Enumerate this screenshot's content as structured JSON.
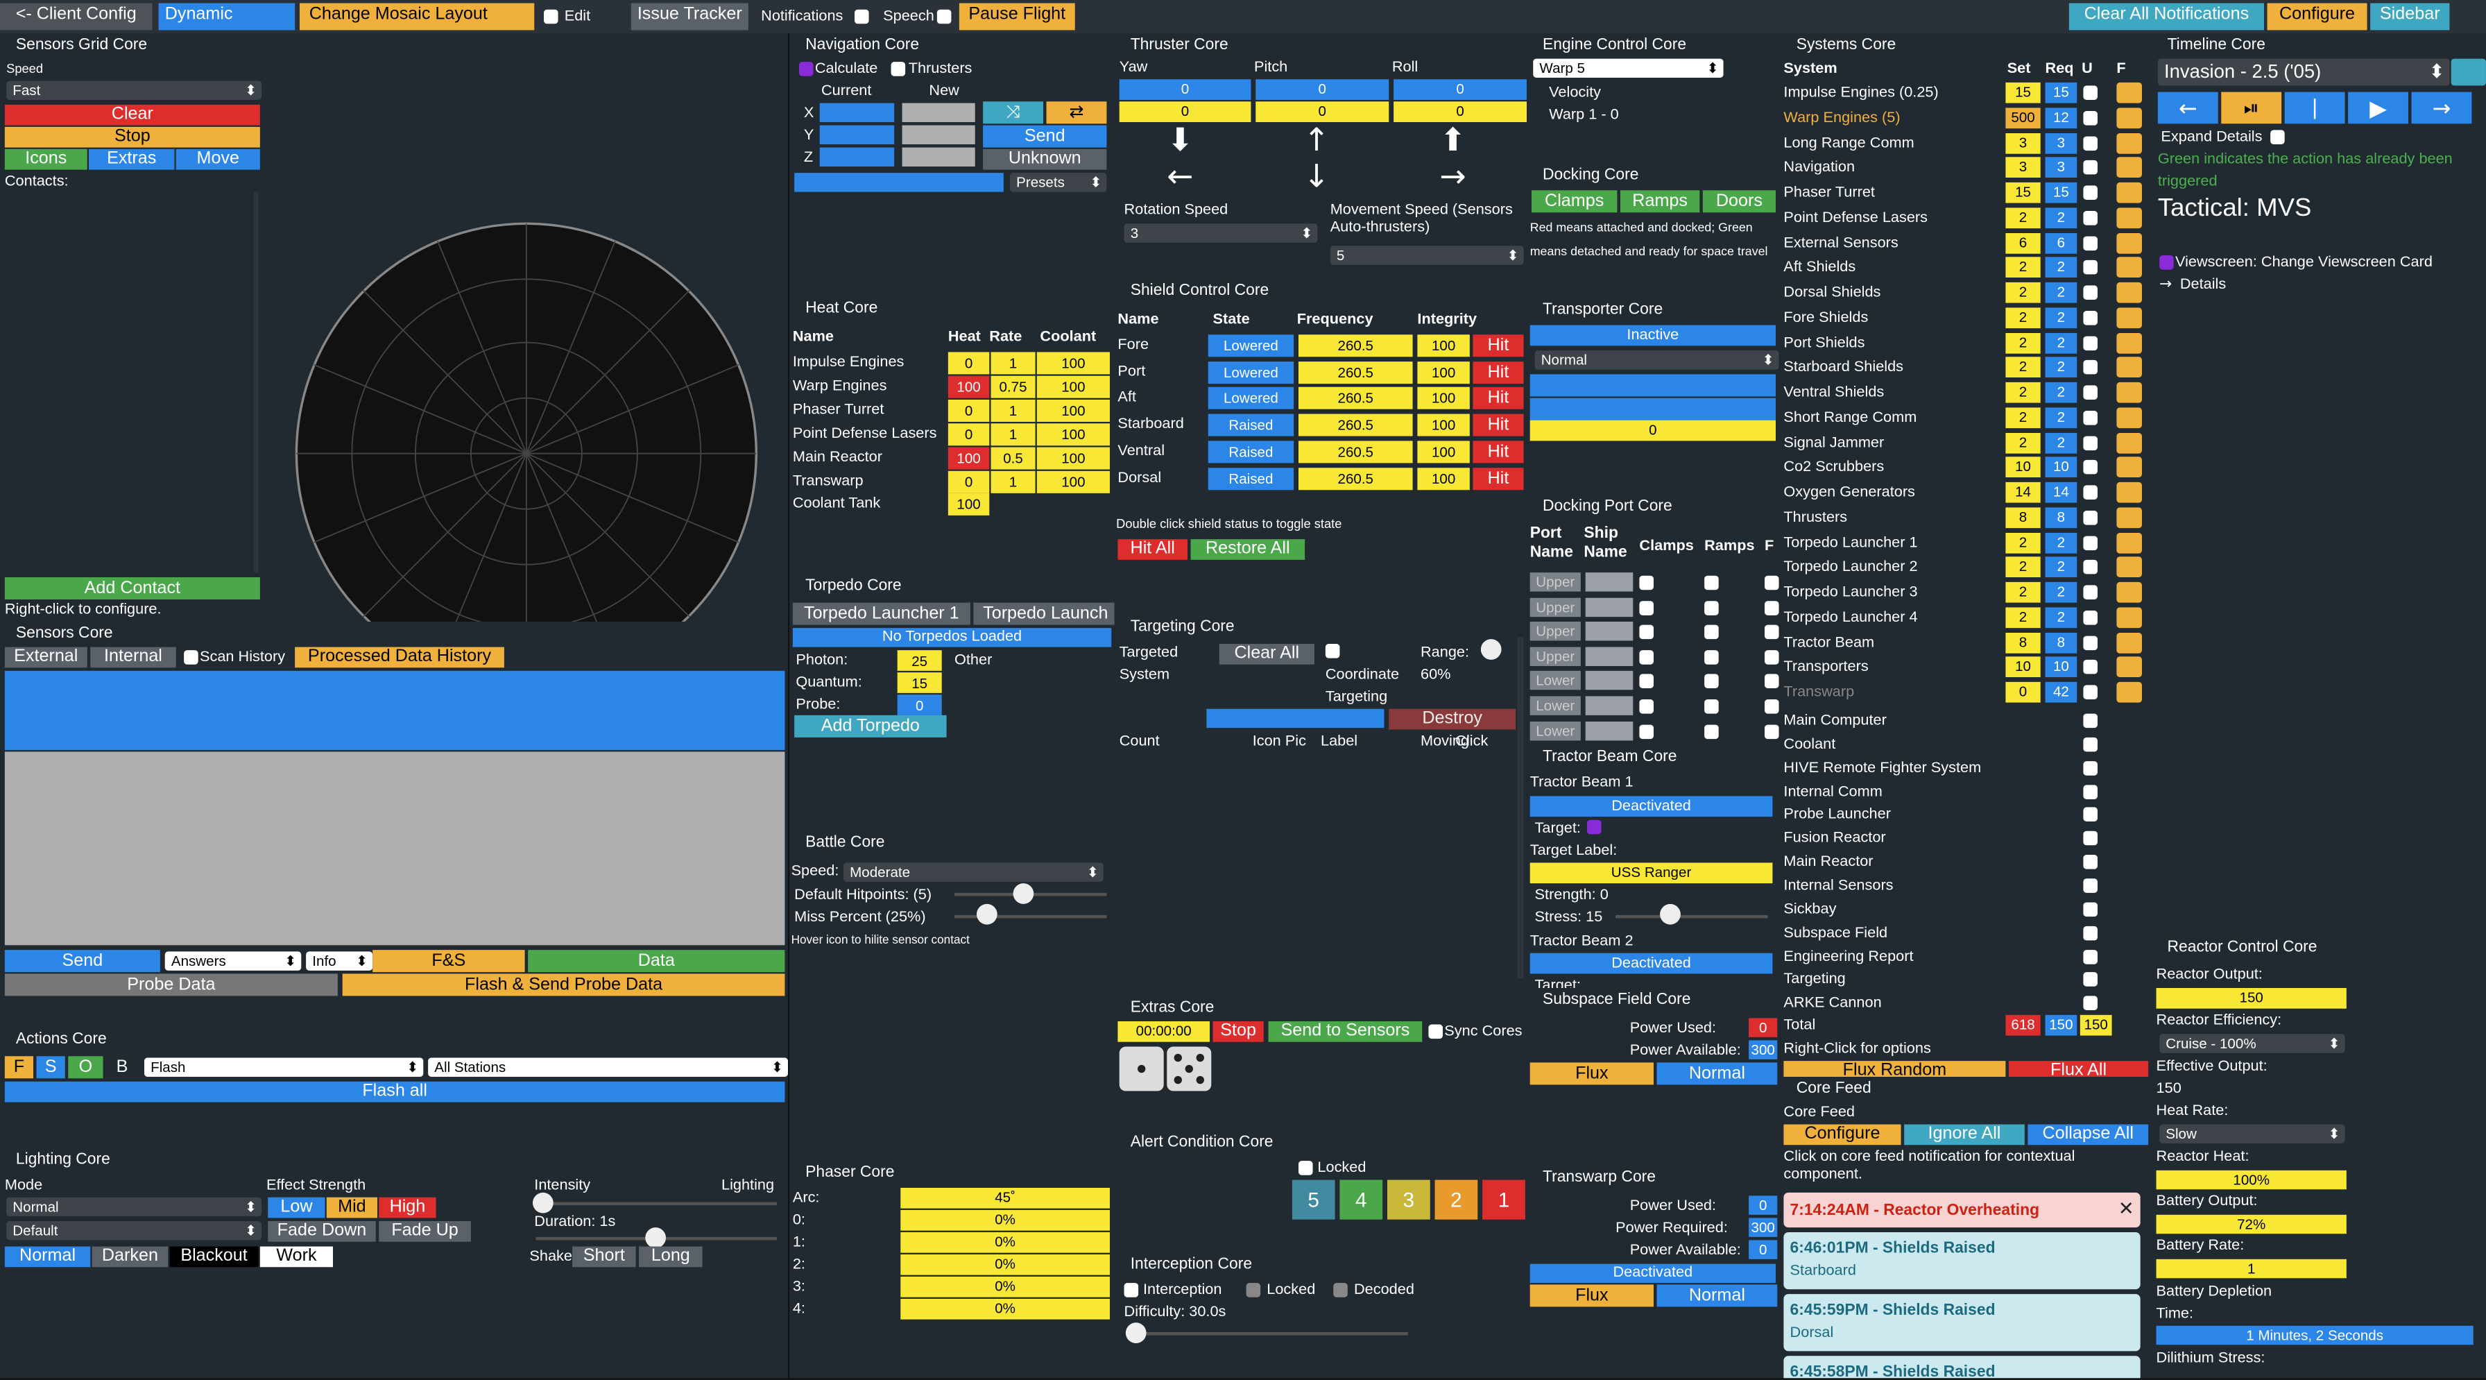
{
  "topbar": {
    "client_config": "<- Client Config",
    "layout": "Dynamic",
    "change_mosaic": "Change Mosaic Layout",
    "edit": "Edit",
    "issue_tracker": "Issue Tracker",
    "notifications": "Notifications",
    "speech": "Speech",
    "pause_flight": "Pause Flight",
    "clear_all": "Clear All Notifications",
    "configure": "Configure",
    "sidebar": "Sidebar"
  },
  "sensors_grid": {
    "title": "Sensors Grid Core",
    "speed_label": "Speed",
    "speed_value": "Fast",
    "clear": "Clear",
    "stop": "Stop",
    "icons": "Icons",
    "extras": "Extras",
    "move": "Move",
    "contacts": "Contacts:",
    "add_contact": "Add Contact",
    "right_click": "Right-click to configure."
  },
  "sensors_core": {
    "title": "Sensors Core",
    "external": "External",
    "internal": "Internal",
    "scan_history": "Scan History",
    "processed": "Processed Data History",
    "send": "Send",
    "answers": "Answers",
    "info": "Info",
    "fs": "F&S",
    "data": "Data",
    "probe_data": "Probe Data",
    "flash_send": "Flash & Send Probe Data"
  },
  "actions": {
    "title": "Actions Core",
    "f": "F",
    "s": "S",
    "o": "O",
    "b": "B",
    "action": "Flash",
    "stations": "All Stations",
    "flash_all": "Flash all"
  },
  "lighting": {
    "title": "Lighting Core",
    "mode": "Mode",
    "mode_value": "Normal",
    "default_value": "Default",
    "effect": "Effect Strength",
    "low": "Low",
    "mid": "Mid",
    "high": "High",
    "fade_down": "Fade Down",
    "fade_up": "Fade Up",
    "normal": "Normal",
    "darken": "Darken",
    "blackout": "Blackout",
    "work": "Work",
    "intensity": "Intensity",
    "lighting": "Lighting",
    "duration": "Duration: 1s",
    "shake": "Shake:",
    "short": "Short",
    "long": "Long"
  },
  "nav": {
    "title": "Navigation Core",
    "calculate": "Calculate",
    "thrusters": "Thrusters",
    "current": "Current",
    "new": "New",
    "x": "X",
    "y": "Y",
    "z": "Z",
    "send": "Send",
    "unknown": "Unknown",
    "presets": "Presets"
  },
  "heat": {
    "title": "Heat Core",
    "headers": [
      "Name",
      "Heat",
      "Rate",
      "Coolant"
    ],
    "rows": [
      [
        "Impulse Engines",
        "0",
        "1",
        "100"
      ],
      [
        "Warp Engines",
        "100",
        "0.75",
        "100"
      ],
      [
        "Phaser Turret",
        "0",
        "1",
        "100"
      ],
      [
        "Point Defense Lasers",
        "0",
        "1",
        "100"
      ],
      [
        "Main Reactor",
        "100",
        "0.5",
        "100"
      ],
      [
        "Transwarp",
        "0",
        "1",
        "100"
      ]
    ],
    "coolant_tank": "Coolant Tank",
    "coolant_value": "100"
  },
  "torpedo": {
    "title": "Torpedo Core",
    "tab1": "Torpedo Launcher 1",
    "tab2": "Torpedo Launch",
    "none": "No Torpedos Loaded",
    "photon": "Photon:",
    "photon_v": "25",
    "other": "Other",
    "quantum": "Quantum:",
    "quantum_v": "15",
    "probe": "Probe:",
    "probe_v": "0",
    "add": "Add Torpedo"
  },
  "battle": {
    "title": "Battle Core",
    "speed": "Speed:",
    "speed_v": "Moderate",
    "hp": "Default  Hitpoints:  (5)",
    "miss": "Miss  Percent  (25%)",
    "hover": "Hover icon to hilite sensor contact"
  },
  "phaser": {
    "title": "Phaser Core",
    "rows": [
      [
        "Arc:",
        "45˚"
      ],
      [
        "0:",
        "0%"
      ],
      [
        "1:",
        "0%"
      ],
      [
        "2:",
        "0%"
      ],
      [
        "3:",
        "0%"
      ],
      [
        "4:",
        "0%"
      ]
    ]
  },
  "thruster": {
    "title": "Thruster Core",
    "yaw": "Yaw",
    "pitch": "Pitch",
    "roll": "Roll",
    "v": "0",
    "rot": "Rotation Speed",
    "rot_v": "3",
    "move": "Movement Speed (Sensors Auto-thrusters)",
    "move_v": "5"
  },
  "shield": {
    "title": "Shield Control Core",
    "headers": [
      "Name",
      "State",
      "Frequency",
      "Integrity"
    ],
    "rows": [
      [
        "Fore",
        "Lowered",
        "260.5",
        "100"
      ],
      [
        "Port",
        "Lowered",
        "260.5",
        "100"
      ],
      [
        "Aft",
        "Lowered",
        "260.5",
        "100"
      ],
      [
        "Starboard",
        "Raised",
        "260.5",
        "100"
      ],
      [
        "Ventral",
        "Raised",
        "260.5",
        "100"
      ],
      [
        "Dorsal",
        "Raised",
        "260.5",
        "100"
      ]
    ],
    "hit": "Hit",
    "note": "Double click shield status to toggle state",
    "hit_all": "Hit All",
    "restore_all": "Restore All"
  },
  "targeting": {
    "title": "Targeting Core",
    "targeted": "Targeted",
    "system": "System",
    "clear_all": "Clear All",
    "coordinate": "Coordinate",
    "targeting": "Targeting",
    "range": "Range:",
    "range_v": "60%",
    "destroy": "Destroy",
    "count": "Count",
    "icon_pic": "Icon Pic",
    "label": "Label",
    "moving": "Moving",
    "click": "Click"
  },
  "extras": {
    "title": "Extras Core",
    "time": "00:00:00",
    "stop": "Stop",
    "send": "Send to Sensors",
    "sync": "Sync Cores"
  },
  "alert": {
    "title": "Alert Condition Core",
    "locked": "Locked",
    "levels": [
      "5",
      "4",
      "3",
      "2",
      "1"
    ]
  },
  "interception": {
    "title": "Interception Core",
    "interception": "Interception",
    "locked": "Locked",
    "decoded": "Decoded",
    "difficulty": "Difficulty: 30.0s"
  },
  "engine": {
    "title": "Engine Control Core",
    "warp": "Warp 5",
    "velocity": "Velocity",
    "warp_v": "Warp 1 - 0"
  },
  "docking": {
    "title": "Docking Core",
    "clamps": "Clamps",
    "ramps": "Ramps",
    "doors": "Doors",
    "note": "Red means attached and docked; Green means detached and ready for space travel"
  },
  "transporter": {
    "title": "Transporter Core",
    "inactive": "Inactive",
    "normal": "Normal",
    "v": "0"
  },
  "docking_port": {
    "title": "Docking Port Core",
    "port": "Port Name",
    "ship": "Ship Name",
    "clamps": "Clamps",
    "ramps": "Ramps",
    "f": "F",
    "ports": [
      "Upper",
      "Upper",
      "Upper",
      "Upper",
      "Lower",
      "Lower",
      "Lower"
    ]
  },
  "tractor": {
    "title": "Tractor Beam Core",
    "b1": "Tractor Beam 1",
    "deactivated": "Deactivated",
    "target": "Target:",
    "target_label": "Target Label:",
    "ranger": "USS Ranger",
    "strength": "Strength: 0",
    "stress": "Stress: 15",
    "b2": "Tractor Beam 2"
  },
  "subspace": {
    "title": "Subspace Field Core",
    "used": "Power Used:",
    "used_v": "0",
    "avail": "Power Available:",
    "avail_v": "300",
    "flux": "Flux",
    "normal": "Normal"
  },
  "transwarp": {
    "title": "Transwarp Core",
    "used": "Power Used:",
    "used_v": "0",
    "req": "Power Required:",
    "req_v": "300",
    "avail": "Power Available:",
    "avail_v": "0",
    "deactivated": "Deactivated",
    "flux": "Flux",
    "normal": "Normal"
  },
  "systems": {
    "title": "Systems Core",
    "headers": [
      "System",
      "Set",
      "Req",
      "U",
      "F"
    ],
    "rows": [
      [
        "Impulse Engines (0.25)",
        "15",
        "15"
      ],
      [
        "Warp Engines (5)",
        "500",
        "12"
      ],
      [
        "Long Range Comm",
        "3",
        "3"
      ],
      [
        "Navigation",
        "3",
        "3"
      ],
      [
        "Phaser Turret",
        "15",
        "15"
      ],
      [
        "Point Defense Lasers",
        "2",
        "2"
      ],
      [
        "External Sensors",
        "6",
        "6"
      ],
      [
        "Aft Shields",
        "2",
        "2"
      ],
      [
        "Dorsal Shields",
        "2",
        "2"
      ],
      [
        "Fore Shields",
        "2",
        "2"
      ],
      [
        "Port Shields",
        "2",
        "2"
      ],
      [
        "Starboard Shields",
        "2",
        "2"
      ],
      [
        "Ventral Shields",
        "2",
        "2"
      ],
      [
        "Short Range Comm",
        "2",
        "2"
      ],
      [
        "Signal Jammer",
        "2",
        "2"
      ],
      [
        "Co2 Scrubbers",
        "10",
        "10"
      ],
      [
        "Oxygen Generators",
        "14",
        "14"
      ],
      [
        "Thrusters",
        "8",
        "8"
      ],
      [
        "Torpedo Launcher 1",
        "2",
        "2"
      ],
      [
        "Torpedo Launcher 2",
        "2",
        "2"
      ],
      [
        "Torpedo Launcher 3",
        "2",
        "2"
      ],
      [
        "Torpedo Launcher 4",
        "2",
        "2"
      ],
      [
        "Tractor Beam",
        "8",
        "8"
      ],
      [
        "Transporters",
        "10",
        "10"
      ],
      [
        "Transwarp",
        "0",
        "42"
      ]
    ],
    "other": [
      "Main Computer",
      "Coolant",
      "HIVE Remote Fighter System",
      "Internal Comm",
      "Probe Launcher",
      "Fusion Reactor",
      "Main Reactor",
      "Internal Sensors",
      "Sickbay",
      "Subspace Field",
      "Engineering Report",
      "Targeting",
      "ARKE Cannon"
    ],
    "total": "Total",
    "total_set": "618",
    "total_req": "150",
    "total_u": "150",
    "right_click": "Right-Click for options",
    "flux_random": "Flux Random",
    "flux_all": "Flux All"
  },
  "core_feed": {
    "title": "Core Feed",
    "sub": "Core Feed",
    "configure": "Configure",
    "ignore": "Ignore All",
    "collapse": "Collapse All",
    "note": "Click on core feed notification for contextual component.",
    "items": [
      [
        "7:14:24AM - Reactor Overheating",
        ""
      ],
      [
        "6:46:01PM - Shields Raised",
        "Starboard"
      ],
      [
        "6:45:59PM - Shields Raised",
        "Dorsal"
      ],
      [
        "6:45:58PM - Shields Raised",
        ""
      ]
    ]
  },
  "timeline": {
    "title": "Timeline Core",
    "mission": "Invasion - 2.5 ('05)",
    "expand": "Expand Details",
    "green_note": "Green indicates the action has already been triggered",
    "tactical": "Tactical: MVS",
    "viewscreen": "Viewscreen: Change Viewscreen Card",
    "details": "Details"
  },
  "reactor": {
    "title": "Reactor Control Core",
    "output": "Reactor Output:",
    "output_v": "150",
    "eff": "Reactor Efficiency:",
    "eff_v": "Cruise - 100%",
    "effective": "Effective Output:",
    "effective_v": "150",
    "heat_rate": "Heat Rate:",
    "heat_rate_v": "Slow",
    "heat": "Reactor Heat:",
    "heat_v": "100%",
    "battery": "Battery Output:",
    "battery_v": "72%",
    "battery_rate": "Battery Rate:",
    "battery_rate_v": "1",
    "depletion": "Battery Depletion Time:",
    "depletion_v": "1 Minutes, 2 Seconds",
    "dilithium": "Dilithium Stress:"
  }
}
